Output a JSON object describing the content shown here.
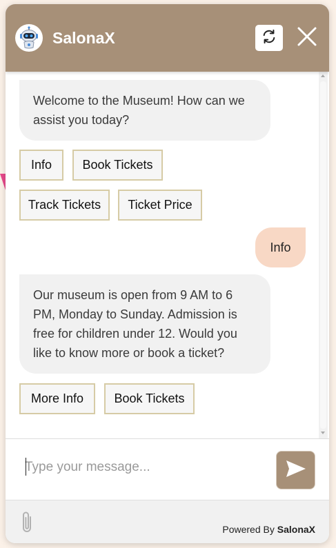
{
  "header": {
    "title": "SalonaX"
  },
  "messages": {
    "bot_welcome": "Welcome to the Museum! How can we assist you today?",
    "options_1": [
      "Info",
      "Book Tickets",
      "Track Tickets",
      "Ticket Price"
    ],
    "user_reply": "Info",
    "bot_info": "Our museum is open from 9 AM to 6 PM, Monday to Sunday. Admission is free for children under 12. Would you like to know more or book a ticket?",
    "options_2": [
      "More Info",
      "Book Tickets"
    ]
  },
  "composer": {
    "placeholder": "Type your message...",
    "value": ""
  },
  "footer": {
    "powered_prefix": "Powered By",
    "brand": "SalonaX"
  },
  "icons": {
    "avatar": "robot-icon",
    "refresh": "refresh-icon",
    "close": "close-icon",
    "send": "send-icon",
    "attach": "paperclip-icon"
  },
  "colors": {
    "brand": "#a79078",
    "user_bubble": "#f8d8c5",
    "bot_bubble": "#f1f1f1",
    "option_border": "#d6cba5"
  }
}
